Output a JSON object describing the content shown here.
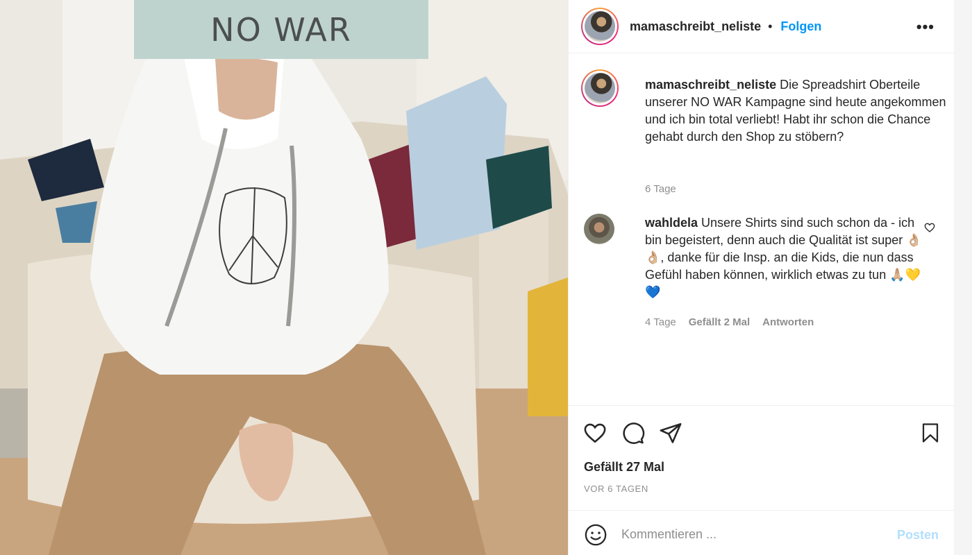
{
  "photo": {
    "banner_text": "NO WAR",
    "alt": "Photo of a child in a white NO WAR hoodie"
  },
  "header": {
    "username": "mamaschreibt_neliste",
    "separator": "•",
    "follow_label": "Folgen",
    "more_label": "•••"
  },
  "caption": {
    "username": "mamaschreibt_neliste",
    "text": "Die Spreadshirt Oberteile unserer NO WAR Kampagne sind heute angekommen und ich bin total verliebt! Habt ihr schon die Chance gehabt durch den Shop zu stöbern?",
    "time": "6 Tage"
  },
  "comment": {
    "username": "wahldela",
    "text": "Unsere Shirts sind such schon da - ich bin begeistert, denn auch die Qualität ist super 👌🏼👌🏼, danke für die Insp. an die Kids, die nun dass Gefühl haben können, wirklich etwas zu tun 🙏🏼💛💙",
    "time": "4 Tage",
    "likes": "Gefällt 2 Mal",
    "reply_label": "Antworten"
  },
  "actions": {
    "icons": [
      "heart-icon",
      "comment-icon",
      "share-icon",
      "bookmark-icon"
    ],
    "likes_label": "Gefällt 27 Mal",
    "date_label": "VOR 6 TAGEN"
  },
  "add_comment": {
    "placeholder": "Kommentieren ...",
    "post_label": "Posten"
  },
  "colors": {
    "link": "#0095f6",
    "post_disabled": "#b2dffc",
    "muted": "#8e8e8e",
    "banner_bg": "#bfd3ce"
  }
}
